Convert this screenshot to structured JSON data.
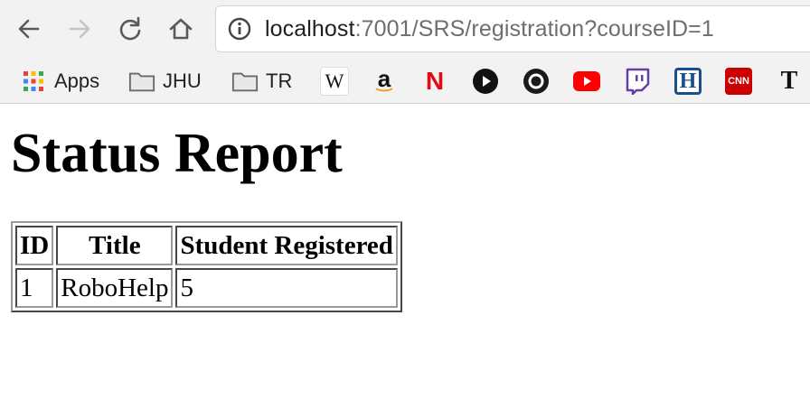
{
  "browser": {
    "url_host": "localhost",
    "url_path": ":7001/SRS/registration?courseID=1",
    "nav": {
      "back_icon": "arrow-left-icon",
      "forward_icon": "arrow-right-icon",
      "reload_icon": "reload-icon",
      "home_icon": "home-icon",
      "info_icon": "info-icon"
    },
    "bookmarks": [
      {
        "label": "Apps",
        "icon": "apps-grid-icon"
      },
      {
        "label": "JHU",
        "icon": "folder-icon"
      },
      {
        "label": "TR",
        "icon": "folder-icon"
      },
      {
        "label": "",
        "icon": "wikipedia-icon",
        "glyph": "W"
      },
      {
        "label": "",
        "icon": "amazon-icon",
        "glyph": "a"
      },
      {
        "label": "",
        "icon": "netflix-icon",
        "glyph": "N"
      },
      {
        "label": "",
        "icon": "play-circle-icon"
      },
      {
        "label": "",
        "icon": "record-circle-icon"
      },
      {
        "label": "",
        "icon": "youtube-icon"
      },
      {
        "label": "",
        "icon": "twitch-icon"
      },
      {
        "label": "",
        "icon": "h-icon",
        "glyph": "H"
      },
      {
        "label": "",
        "icon": "cnn-icon",
        "glyph": "CNN"
      },
      {
        "label": "",
        "icon": "nyt-icon",
        "glyph": "T"
      }
    ]
  },
  "page": {
    "title": "Status Report",
    "table": {
      "headers": [
        "ID",
        "Title",
        "Student Registered"
      ],
      "rows": [
        [
          "1",
          "RoboHelp",
          "5"
        ]
      ]
    }
  }
}
